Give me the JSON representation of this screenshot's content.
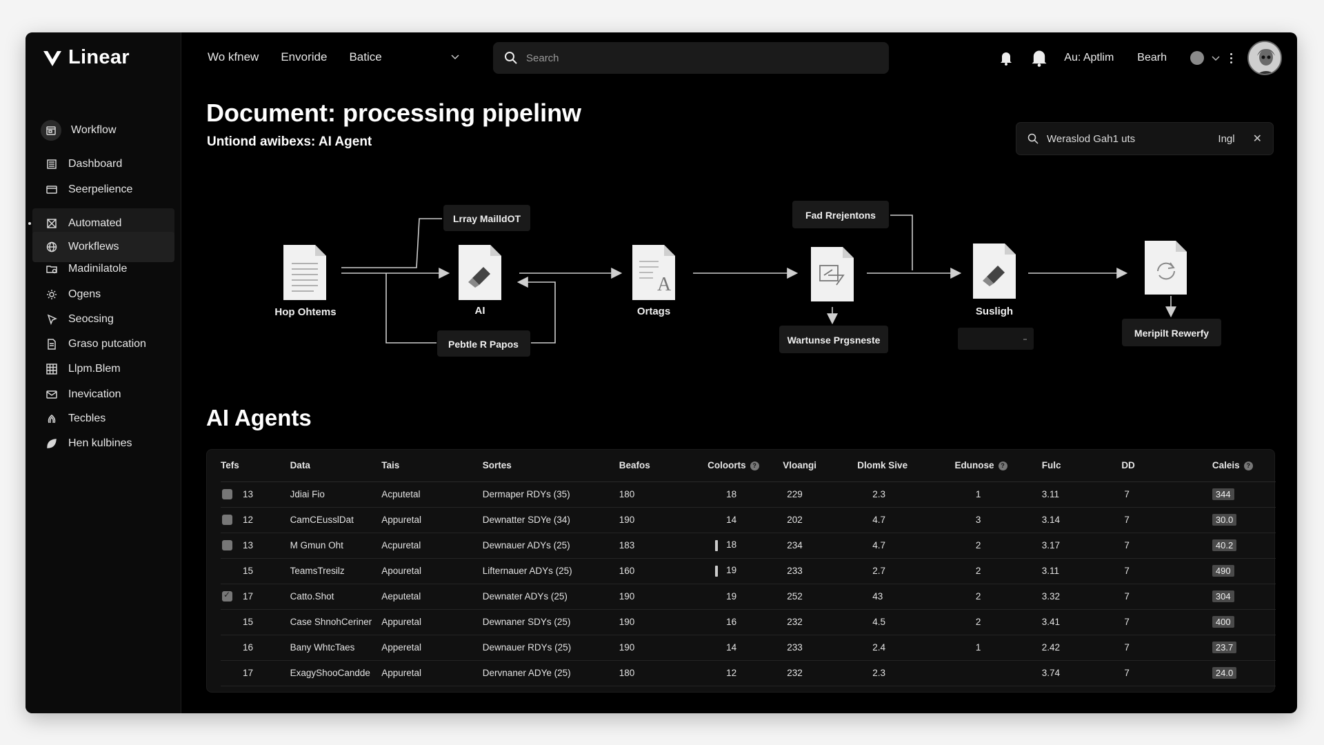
{
  "app": {
    "name": "Linear"
  },
  "sidebar": {
    "items": [
      {
        "label": "Workflow",
        "icon": "calendar-icon",
        "style": "top"
      },
      {
        "label": "Dashboard",
        "icon": "list-icon"
      },
      {
        "label": "Seerpelience",
        "icon": "card-icon"
      },
      {
        "label": "Automated",
        "icon": "box-x-icon",
        "style": "grouped"
      },
      {
        "label": "Workflews",
        "icon": "globe-icon",
        "style": "grouped-sub"
      },
      {
        "label": "Madinilatole",
        "icon": "folder-icon"
      },
      {
        "label": "Ogens",
        "icon": "cog-icon"
      },
      {
        "label": "Seocsing",
        "icon": "pointer-icon"
      },
      {
        "label": "Graso putcation",
        "icon": "doc-icon"
      },
      {
        "label": "Llpm.Blem",
        "icon": "grid-icon"
      },
      {
        "label": "Inevication",
        "icon": "mail-icon"
      },
      {
        "label": "Tecbles",
        "icon": "fingerprint-icon"
      },
      {
        "label": "Hen kulbines",
        "icon": "leaf-icon"
      }
    ]
  },
  "topbar": {
    "tabs": [
      "Wo kfnew",
      "Envoride",
      "Batice"
    ],
    "search_placeholder": "Search",
    "user_label": "Au: Aptlim",
    "search_label": "Bearh"
  },
  "page": {
    "title": "Document: processing pipelinw",
    "subtitle": "Untiond awibexs: AI Agent",
    "filter_value": "Weraslod Gah1 uts",
    "filter_lang": "Ingl"
  },
  "pipeline": {
    "nodes": [
      {
        "label": "Hop Ohtems",
        "icon": "document-icon"
      },
      {
        "label": "AI",
        "icon": "eraser-doc-icon"
      },
      {
        "label": "Ortags",
        "icon": "text-doc-icon"
      },
      {
        "label": "",
        "icon": "transform-doc-icon"
      },
      {
        "label": "Susligh",
        "icon": "eraser-doc-icon"
      },
      {
        "label": "",
        "icon": "refresh-doc-icon"
      }
    ],
    "boxes": [
      {
        "label": "Lrray MailldOT"
      },
      {
        "label": "Pebtle R Papos"
      },
      {
        "label": "Fad Rrejentons"
      },
      {
        "label": "Wartunse Prgsneste"
      },
      {
        "label": "Meripilt Rewerfy"
      }
    ]
  },
  "agents": {
    "title": "AI Agents",
    "columns": [
      "Tefs",
      "Data",
      "Tais",
      "Sortes",
      "Beafos",
      "Coloorts",
      "Vloangi",
      "Dlomk Sive",
      "Edunose",
      "Fulc",
      "DD",
      "Caleis"
    ],
    "rows": [
      {
        "check": "box",
        "bar": false,
        "cells": [
          "13",
          "Jdiai Fio",
          "Acputetal",
          "Dermaper RDYs (35)",
          "180",
          "18",
          "229",
          "2.3",
          "1",
          "3.11",
          "7",
          "344"
        ]
      },
      {
        "check": "box",
        "bar": false,
        "cells": [
          "12",
          "CamCEusslDat",
          "Appuretal",
          "Dewnatter SDYe (34)",
          "190",
          "14",
          "202",
          "4.7",
          "3",
          "3.14",
          "7",
          "30.0"
        ]
      },
      {
        "check": "box",
        "bar": true,
        "cells": [
          "13",
          "M Gmun Oht",
          "Acpuretal",
          "Dewnauer ADYs (25)",
          "183",
          "18",
          "234",
          "4.7",
          "2",
          "3.17",
          "7",
          "40.2"
        ]
      },
      {
        "check": "none",
        "bar": true,
        "cells": [
          "15",
          "TeamsTresilz",
          "Apouretal",
          "Lifternauer ADYs (25)",
          "160",
          "19",
          "233",
          "2.7",
          "2",
          "3.11",
          "7",
          "490"
        ]
      },
      {
        "check": "checked",
        "bar": false,
        "cells": [
          "17",
          "Catto.Shot",
          "Aeputetal",
          "Dewnater ADYs (25)",
          "190",
          "19",
          "252",
          "43",
          "2",
          "3.32",
          "7",
          "304"
        ]
      },
      {
        "check": "none",
        "bar": false,
        "cells": [
          "15",
          "Case ShnohCeriner",
          "Appuretal",
          "Dewnaner SDYs (25)",
          "190",
          "16",
          "232",
          "4.5",
          "2",
          "3.41",
          "7",
          "400"
        ]
      },
      {
        "check": "none",
        "bar": false,
        "cells": [
          "16",
          "Bany WhtcTaes",
          "Apperetal",
          "Dewnauer RDYs (25)",
          "190",
          "14",
          "233",
          "2.4",
          "1",
          "2.42",
          "7",
          "23.7"
        ]
      },
      {
        "check": "none",
        "bar": false,
        "cells": [
          "17",
          "ExagyShooCandde",
          "Appuretal",
          "Dervnaner ADYe (25)",
          "180",
          "12",
          "232",
          "2.3",
          "",
          "3.74",
          "7",
          "24.0"
        ]
      }
    ]
  }
}
